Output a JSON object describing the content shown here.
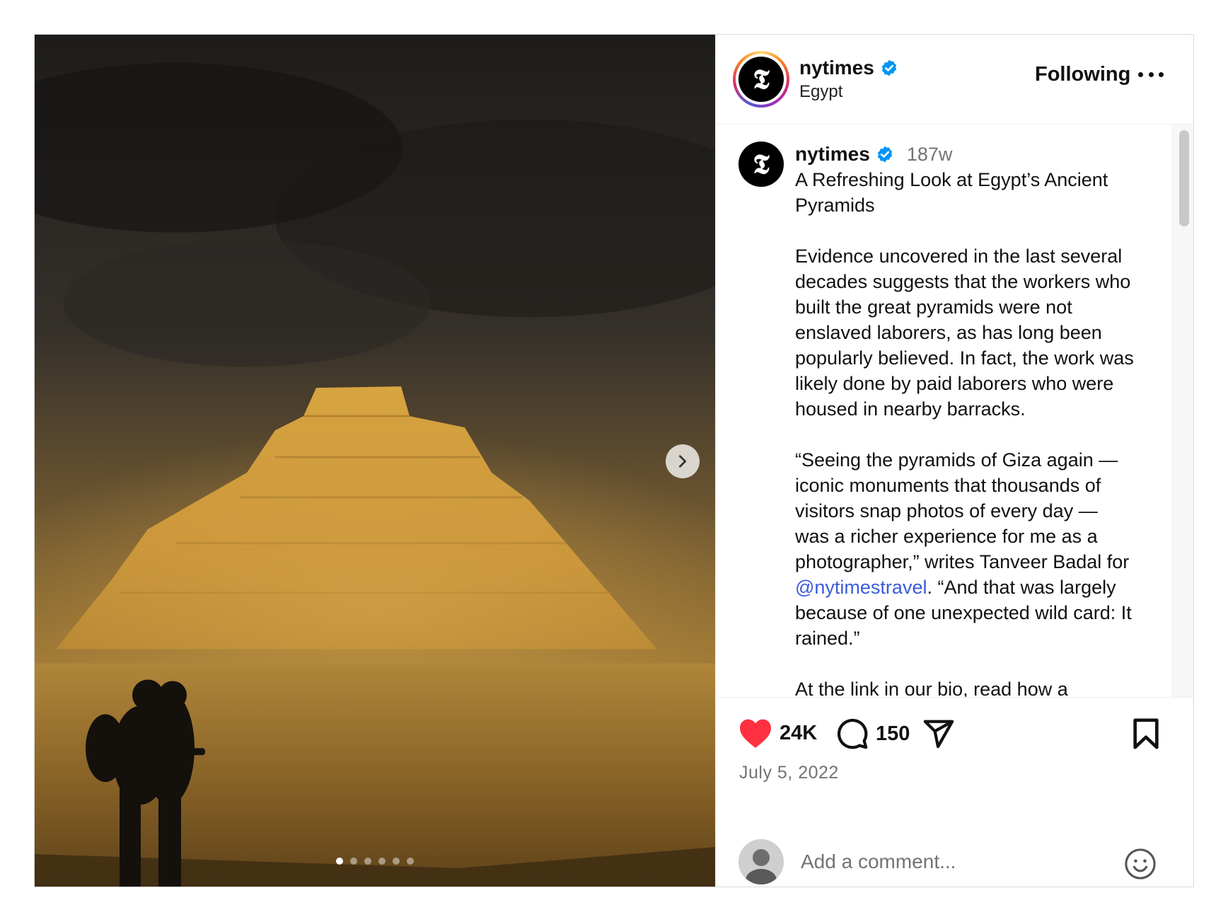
{
  "post": {
    "author": "nytimes",
    "logo_letter": "𝕿",
    "location": "Egypt",
    "follow_state": "Following",
    "time_ago": "187w",
    "caption_title": "A Refreshing Look at Egypt’s Ancient Pyramids",
    "caption_p1": "Evidence uncovered in the last several decades suggests that the workers who built the great pyramids were not enslaved laborers, as has long been popularly believed. In fact, the work was likely done by paid laborers who were housed in nearby barracks.",
    "caption_p2_before": "“Seeing the pyramids of Giza again — iconic monuments that thousands of visitors snap photos of every day — was a richer experience for me as a photographer,” writes Tanveer Badal for ",
    "caption_mention": "@nytimestravel",
    "caption_p2_after": ". “And that was largely because of one unexpected wild card: It rained.”",
    "caption_p3": "At the link in our bio, read how a",
    "likes": "24K",
    "comments": "150",
    "date": "July 5, 2022",
    "carousel": {
      "count": 6,
      "active": 1
    }
  },
  "comment": {
    "placeholder": "Add a comment..."
  },
  "icons": {
    "like": "heart-filled-icon",
    "comment": "comment-bubble-icon",
    "share": "paper-plane-icon",
    "save": "bookmark-icon",
    "more": "more-dots-icon",
    "next": "chevron-right-icon",
    "emoji": "smiley-icon",
    "verified": "verified-badge-icon"
  },
  "colors": {
    "like_red": "#ff3040",
    "verified_blue": "#0095f6",
    "mention": "#3b5bdb",
    "muted": "#737373"
  }
}
